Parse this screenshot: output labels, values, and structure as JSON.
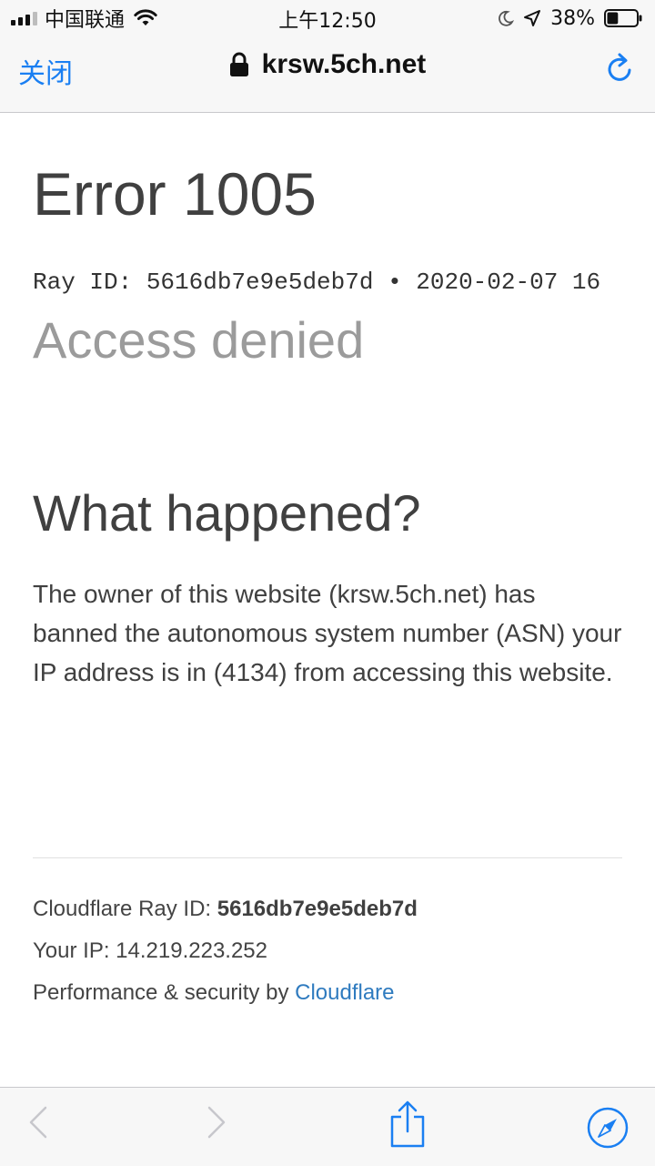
{
  "status_bar": {
    "carrier": "中国联通",
    "time": "上午12:50",
    "battery_percent": "38%",
    "battery_level": 0.38,
    "icons": [
      "signal-icon",
      "wifi-icon",
      "moon-icon",
      "location-icon",
      "battery-icon"
    ]
  },
  "nav": {
    "close_label": "关闭",
    "url": "krsw.5ch.net",
    "icons": [
      "lock-icon",
      "reload-icon"
    ],
    "accent": "#1a7ff2"
  },
  "page": {
    "error_title": "Error 1005",
    "ray_line": "Ray ID: 5616db7e9e5deb7d • 2020-02-07 16",
    "access_denied": "Access denied",
    "what_happened": "What happened?",
    "body": "The owner of this website (krsw.5ch.net) has banned the autonomous system number (ASN) your IP address is in (4134) from accessing this website.",
    "footer": {
      "ray_label": "Cloudflare Ray ID: ",
      "ray_value": "5616db7e9e5deb7d",
      "ip_label": "Your IP: ",
      "ip_value": "14.219.223.252",
      "perf_label": "Performance & security by ",
      "perf_link": "Cloudflare",
      "link_color": "#2f7bbf"
    }
  },
  "toolbar": {
    "icons": [
      "back-icon",
      "forward-icon",
      "share-icon",
      "safari-compass-icon"
    ]
  }
}
